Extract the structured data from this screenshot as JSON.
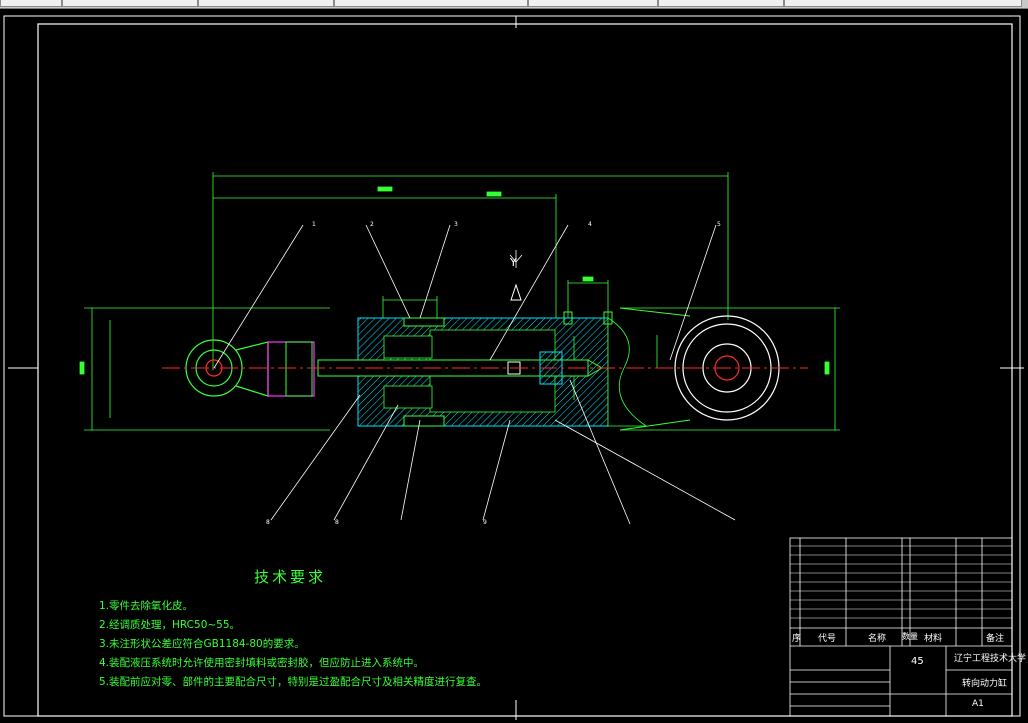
{
  "window": {
    "tabs": [
      "",
      "",
      "",
      "",
      "",
      "",
      ""
    ]
  },
  "drawing": {
    "balloons": {
      "top": [
        "1",
        "2",
        "3",
        "4",
        "5"
      ],
      "bottom_left": [
        "8",
        "8",
        "9"
      ]
    },
    "axis_label": "Y",
    "colors": {
      "background": "#000000",
      "frame": "#ffffff",
      "outline": "#37ff37",
      "hatch": "#00e5ff",
      "centerline": "#ff2a2a",
      "magenta": "#ff33ff",
      "text": "#37ff37"
    }
  },
  "tech_requirements": {
    "title": "技术要求",
    "items": [
      "1.零件去除氧化皮。",
      "2.经调质处理，HRC50~55。",
      "3.未注形状公差应符合GB1184-80的要求。",
      "4.装配液压系统时允许使用密封填料或密封胶，但应防止进入系统中。",
      "5.装配前应对零、部件的主要配合尺寸，特别是过盈配合尺寸及相关精度进行复查。"
    ]
  },
  "title_block": {
    "header": {
      "seq": "序",
      "code": "代号",
      "name": "名称",
      "qty": "数量",
      "material": "材料",
      "remark": "备注"
    },
    "material_value": "45",
    "school": "辽宁工程技术大学",
    "drawing_title": "转向动力缸",
    "sheet_size": "A1"
  }
}
